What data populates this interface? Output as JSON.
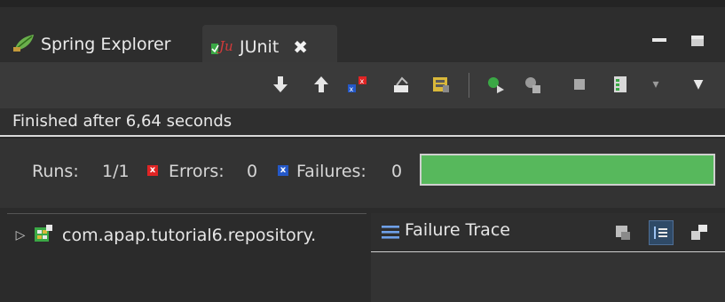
{
  "tabs": [
    {
      "label": "Spring Explorer",
      "icon": "spring-leaf-icon"
    },
    {
      "label": "JUnit",
      "icon": "junit-icon",
      "close_glyph": "✖"
    }
  ],
  "status_text": "Finished after 6,64 seconds",
  "counters": {
    "runs_label": "Runs:",
    "runs_value": "1/1",
    "errors_label": "Errors:",
    "errors_value": "0",
    "failures_label": "Failures:",
    "failures_value": "0",
    "progress_color": "#57b85c",
    "progress_fraction": 1.0
  },
  "test_tree": {
    "items": [
      {
        "label": "com.apap.tutorial6.repository.",
        "icon": "test-class-icon",
        "expanded": false
      }
    ]
  },
  "failure_trace": {
    "title": "Failure Trace"
  },
  "colors": {
    "error_red": "#e02424",
    "failure_blue": "#2458c8",
    "success_green": "#57b85c"
  }
}
